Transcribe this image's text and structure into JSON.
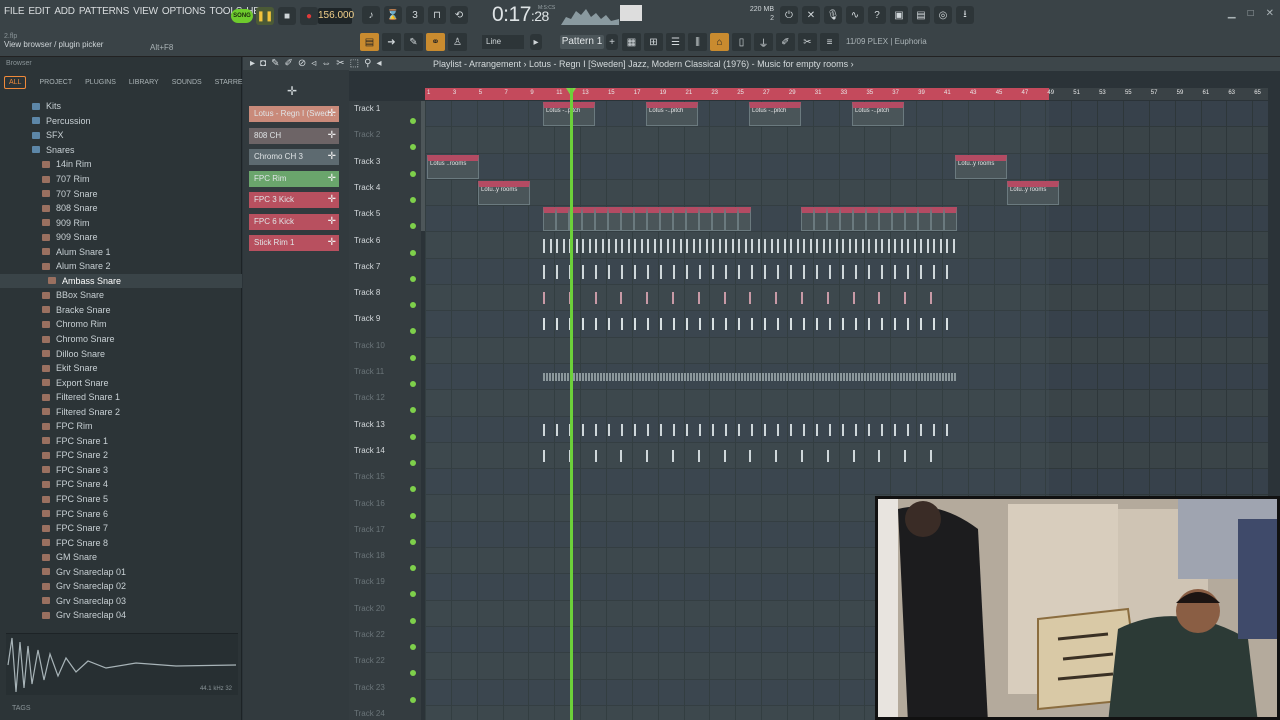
{
  "menu": [
    "FILE",
    "EDIT",
    "ADD",
    "PATTERNS",
    "VIEW",
    "OPTIONS",
    "TOOLS",
    "HELP"
  ],
  "hint": {
    "project": "2.flp",
    "text": "View browser / plugin picker",
    "keys": "Alt+F8"
  },
  "transport": {
    "mode": "SONG",
    "tempo": "156.000",
    "time": "0:17",
    "time_sub": ":28",
    "time_label": "M:S:CS"
  },
  "memory": {
    "line1": "220 MB",
    "line2": "2"
  },
  "pattern": "Pattern 1",
  "snap": "Line",
  "plugin_info": "11/09  PLEX | Euphoria",
  "browser": {
    "title": "Browser",
    "tabs": [
      "ALL",
      "PROJECT",
      "PLUGINS",
      "LIBRARY",
      "SOUNDS",
      "STARRED"
    ],
    "items": [
      {
        "label": "Kits",
        "kind": "folder",
        "indent": 1
      },
      {
        "label": "Percussion",
        "kind": "folder",
        "indent": 1
      },
      {
        "label": "SFX",
        "kind": "folder",
        "indent": 1
      },
      {
        "label": "Snares",
        "kind": "folder",
        "indent": 1
      },
      {
        "label": "14in Rim",
        "kind": "file",
        "indent": 2
      },
      {
        "label": "707 Rim",
        "kind": "file",
        "indent": 2
      },
      {
        "label": "707 Snare",
        "kind": "file",
        "indent": 2
      },
      {
        "label": "808 Snare",
        "kind": "file",
        "indent": 2
      },
      {
        "label": "909 Rim",
        "kind": "file",
        "indent": 2
      },
      {
        "label": "909 Snare",
        "kind": "file",
        "indent": 2
      },
      {
        "label": "Alum Snare 1",
        "kind": "file",
        "indent": 2
      },
      {
        "label": "Alum Snare 2",
        "kind": "file",
        "indent": 2
      },
      {
        "label": "Ambass Snare",
        "kind": "file",
        "indent": 3,
        "selected": true
      },
      {
        "label": "BBox Snare",
        "kind": "file",
        "indent": 2
      },
      {
        "label": "Bracke Snare",
        "kind": "file",
        "indent": 2
      },
      {
        "label": "Chromo Rim",
        "kind": "file",
        "indent": 2
      },
      {
        "label": "Chromo Snare",
        "kind": "file",
        "indent": 2
      },
      {
        "label": "Dilloo Snare",
        "kind": "file",
        "indent": 2
      },
      {
        "label": "Ekit Snare",
        "kind": "file",
        "indent": 2
      },
      {
        "label": "Export Snare",
        "kind": "file",
        "indent": 2
      },
      {
        "label": "Filtered Snare 1",
        "kind": "file",
        "indent": 2
      },
      {
        "label": "Filtered Snare 2",
        "kind": "file",
        "indent": 2
      },
      {
        "label": "FPC Rim",
        "kind": "file",
        "indent": 2
      },
      {
        "label": "FPC Snare 1",
        "kind": "file",
        "indent": 2
      },
      {
        "label": "FPC Snare 2",
        "kind": "file",
        "indent": 2
      },
      {
        "label": "FPC Snare 3",
        "kind": "file",
        "indent": 2
      },
      {
        "label": "FPC Snare 4",
        "kind": "file",
        "indent": 2
      },
      {
        "label": "FPC Snare 5",
        "kind": "file",
        "indent": 2
      },
      {
        "label": "FPC Snare 6",
        "kind": "file",
        "indent": 2
      },
      {
        "label": "FPC Snare 7",
        "kind": "file",
        "indent": 2
      },
      {
        "label": "FPC Snare 8",
        "kind": "file",
        "indent": 2
      },
      {
        "label": "GM Snare",
        "kind": "file",
        "indent": 2
      },
      {
        "label": "Grv Snareclap 01",
        "kind": "file",
        "indent": 2
      },
      {
        "label": "Grv Snareclap 02",
        "kind": "file",
        "indent": 2
      },
      {
        "label": "Grv Snareclap 03",
        "kind": "file",
        "indent": 2
      },
      {
        "label": "Grv Snareclap 04",
        "kind": "file",
        "indent": 2
      }
    ],
    "sample_rate": "44.1 kHz 32",
    "tags": "TAGS"
  },
  "channels": [
    {
      "label": "Lotus - Regn I (Swed...",
      "color": "#c98a7a"
    },
    {
      "label": "808 CH",
      "color": "#6d6466"
    },
    {
      "label": "Chromo CH 3",
      "color": "#5d6a70"
    },
    {
      "label": "FPC Rim",
      "color": "#6aa56c"
    },
    {
      "label": "FPC 3 Kick",
      "color": "#b8505f"
    },
    {
      "label": "FPC 6 Kick",
      "color": "#b8505f"
    },
    {
      "label": "Stick Rim 1",
      "color": "#b8505f"
    }
  ],
  "playlist": {
    "title": "Playlist - Arrangement › Lotus - Regn I [Sweden] Jazz, Modern Classical (1976) - Music for empty rooms ›",
    "ruler": [
      "1",
      "3",
      "5",
      "7",
      "9",
      "11",
      "13",
      "15",
      "17",
      "19",
      "21",
      "23",
      "25",
      "27",
      "29",
      "31",
      "33",
      "35",
      "37",
      "39",
      "41",
      "43",
      "45",
      "47",
      "49",
      "51",
      "53",
      "55",
      "57",
      "59",
      "61",
      "63",
      "65"
    ],
    "tracks": [
      {
        "name": "Track 1",
        "dim": false
      },
      {
        "name": "Track 2",
        "dim": true
      },
      {
        "name": "Track 3",
        "dim": false
      },
      {
        "name": "Track 4",
        "dim": false
      },
      {
        "name": "Track 5",
        "dim": false
      },
      {
        "name": "Track 6",
        "dim": false
      },
      {
        "name": "Track 7",
        "dim": false
      },
      {
        "name": "Track 8",
        "dim": false
      },
      {
        "name": "Track 9",
        "dim": false
      },
      {
        "name": "Track 10",
        "dim": true
      },
      {
        "name": "Track 11",
        "dim": true
      },
      {
        "name": "Track 12",
        "dim": true
      },
      {
        "name": "Track 13",
        "dim": false
      },
      {
        "name": "Track 14",
        "dim": false
      },
      {
        "name": "Track 15",
        "dim": true
      },
      {
        "name": "Track 16",
        "dim": true
      },
      {
        "name": "Track 17",
        "dim": true
      },
      {
        "name": "Track 18",
        "dim": true
      },
      {
        "name": "Track 19",
        "dim": true
      },
      {
        "name": "Track 20",
        "dim": true
      },
      {
        "name": "Track 22",
        "dim": true
      },
      {
        "name": "Track 22",
        "dim": true
      },
      {
        "name": "Track 23",
        "dim": true
      },
      {
        "name": "Track 24",
        "dim": true
      }
    ],
    "clip_labels": {
      "pitch": "Lotus -..pitch",
      "rooms": "Lotus ..rooms",
      "rooms2": "Lotu..y rooms"
    }
  }
}
